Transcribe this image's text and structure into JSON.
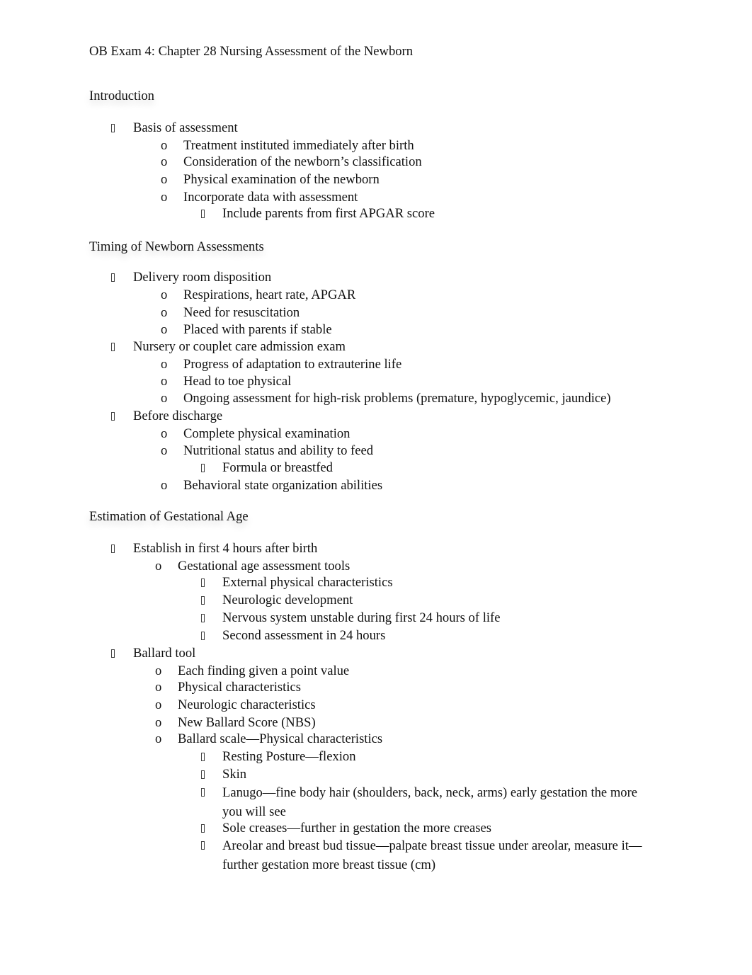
{
  "document": {
    "title": "OB Exam 4: Chapter 28 Nursing Assessment of the Newborn",
    "sections": [
      {
        "heading": "Introduction",
        "items": [
          {
            "level": 1,
            "bullet": "box",
            "text": "Basis of assessment"
          },
          {
            "level": 2,
            "bullet": "o",
            "text": "Treatment instituted immediately after birth"
          },
          {
            "level": 2,
            "bullet": "o",
            "text": "Consideration of the newborn’s classification"
          },
          {
            "level": 2,
            "bullet": "o",
            "text": "Physical examination of the newborn"
          },
          {
            "level": 2,
            "bullet": "o",
            "text": "Incorporate data with assessment"
          },
          {
            "level": 3,
            "bullet": "box",
            "text": "Include parents from first APGAR score"
          }
        ]
      },
      {
        "heading": "Timing of Newborn Assessments",
        "items": [
          {
            "level": 1,
            "bullet": "box",
            "text": "Delivery room disposition"
          },
          {
            "level": 2,
            "bullet": "o",
            "text": "Respirations, heart rate, APGAR"
          },
          {
            "level": 2,
            "bullet": "o",
            "text": "Need for resuscitation"
          },
          {
            "level": 2,
            "bullet": "o",
            "text": "Placed with parents if stable"
          },
          {
            "level": 1,
            "bullet": "box",
            "text": "Nursery or couplet care admission exam"
          },
          {
            "level": 2,
            "bullet": "o",
            "text": "Progress of adaptation to extrauterine life"
          },
          {
            "level": 2,
            "bullet": "o",
            "text": "Head to toe physical"
          },
          {
            "level": 2,
            "bullet": "o",
            "text": "Ongoing assessment for high-risk problems (premature, hypoglycemic, jaundice)"
          },
          {
            "level": 1,
            "bullet": "box",
            "text": "Before discharge"
          },
          {
            "level": 2,
            "bullet": "o",
            "text": "Complete physical examination"
          },
          {
            "level": 2,
            "bullet": "o",
            "text": "Nutritional status and ability to feed"
          },
          {
            "level": 3,
            "bullet": "box",
            "text": "Formula or breastfed"
          },
          {
            "level": 2,
            "bullet": "o",
            "text": "Behavioral state organization abilities"
          }
        ]
      },
      {
        "heading": "Estimation of Gestational Age",
        "items": [
          {
            "level": 1,
            "bullet": "box",
            "text": "Establish in first 4 hours after birth"
          },
          {
            "level": 2,
            "bullet": "o",
            "text": "Gestational age assessment tools"
          },
          {
            "level": 3,
            "bullet": "box",
            "text": "External physical characteristics"
          },
          {
            "level": 3,
            "bullet": "box",
            "text": "Neurologic development"
          },
          {
            "level": 3,
            "bullet": "box",
            "text": "Nervous system unstable during first 24 hours of life"
          },
          {
            "level": 3,
            "bullet": "box",
            "text": "Second assessment in 24 hours"
          },
          {
            "level": 1,
            "bullet": "box",
            "text": "Ballard tool"
          },
          {
            "level": 2,
            "bullet": "o",
            "text": "Each finding given a point value"
          },
          {
            "level": 2,
            "bullet": "o",
            "text": "Physical characteristics"
          },
          {
            "level": 2,
            "bullet": "o",
            "text": "Neurologic characteristics"
          },
          {
            "level": 2,
            "bullet": "o",
            "text": "New Ballard Score (NBS)"
          },
          {
            "level": 2,
            "bullet": "o",
            "text": "Ballard scale—Physical characteristics"
          },
          {
            "level": 3,
            "bullet": "box",
            "text": "Resting Posture—flexion"
          },
          {
            "level": 3,
            "bullet": "box",
            "text": "Skin"
          },
          {
            "level": 3,
            "bullet": "box",
            "text": "Lanugo—fine body hair (shoulders, back, neck, arms) early gestation the more you will see"
          },
          {
            "level": 3,
            "bullet": "box",
            "text": "Sole creases—further in gestation the more creases"
          },
          {
            "level": 3,
            "bullet": "box",
            "text": "Areolar and breast bud tissue—palpate breast tissue under areolar, measure it—further gestation more breast tissue (cm)"
          }
        ]
      }
    ]
  }
}
